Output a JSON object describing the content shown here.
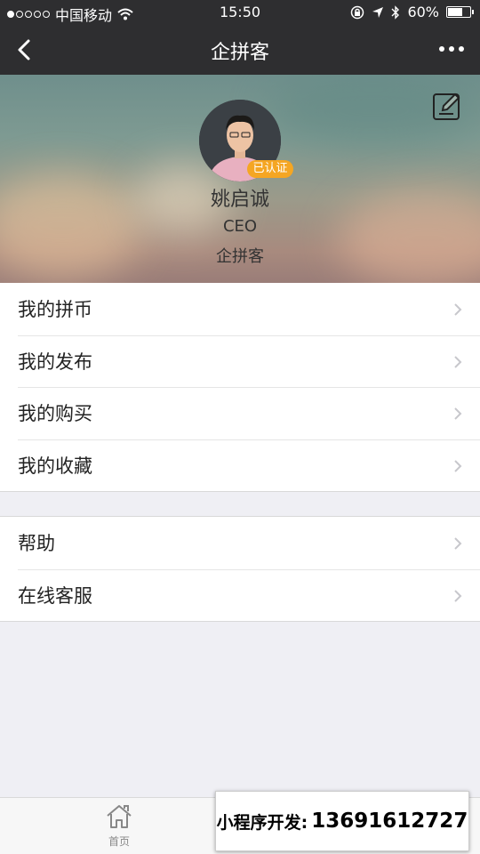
{
  "status_bar": {
    "carrier": "中国移动",
    "time": "15:50",
    "battery_text": "60%",
    "battery_level": 0.6
  },
  "nav": {
    "title": "企拼客"
  },
  "profile": {
    "verified_badge": "已认证",
    "name": "姚启诚",
    "role": "CEO",
    "company": "企拼客"
  },
  "menu_group_1": [
    {
      "label": "我的拼币"
    },
    {
      "label": "我的发布"
    },
    {
      "label": "我的购买"
    },
    {
      "label": "我的收藏"
    }
  ],
  "menu_group_2": [
    {
      "label": "帮助"
    },
    {
      "label": "在线客服"
    }
  ],
  "tab_bar": {
    "home_label": "首页"
  },
  "promo": {
    "label": "小程序开发:",
    "phone": "13691612727"
  },
  "icons": [
    "signal-icon",
    "wifi-icon",
    "lock-rotation-icon",
    "location-icon",
    "bluetooth-icon",
    "battery-icon",
    "back-icon",
    "more-icon",
    "edit-icon",
    "chevron-right-icon",
    "home-icon"
  ]
}
